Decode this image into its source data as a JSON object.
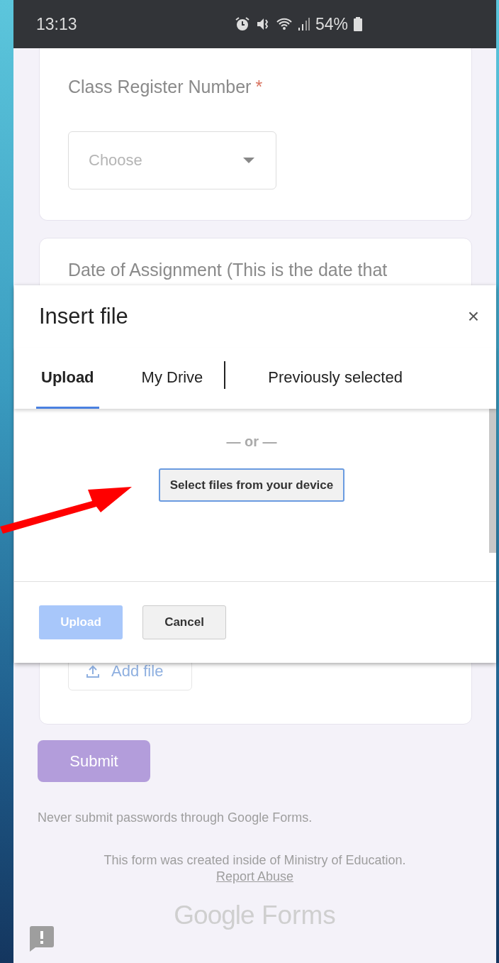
{
  "status_bar": {
    "time": "13:13",
    "battery": "54%"
  },
  "questions": [
    {
      "kind": "dropdown",
      "label": "Class Register Number",
      "asterisk": "*",
      "placeholder": "Choose"
    },
    {
      "kind": "file",
      "label": "Date of Assignment (This is the date that",
      "button": "Add file"
    }
  ],
  "dialog": {
    "title": "Insert file",
    "close": "×",
    "tabs": [
      {
        "label": "Upload",
        "selected": true,
        "divider_before": false
      },
      {
        "label": "My Drive",
        "selected": false,
        "divider_before": false
      },
      {
        "label": "Previously selected",
        "selected": false,
        "divider_before": true
      }
    ],
    "separator": "— or —",
    "select_button": "Select files from your device",
    "buttons": [
      {
        "label": "Upload",
        "disabled": true
      },
      {
        "label": "Cancel",
        "disabled": false
      }
    ]
  },
  "submit": "Submit",
  "warning": "Never submit passwords through Google Forms.",
  "footer": {
    "text": "This form was created inside of Ministry of Education.",
    "link": "Report Abuse"
  },
  "logo": {
    "brand": "Google",
    "product": "Forms"
  }
}
